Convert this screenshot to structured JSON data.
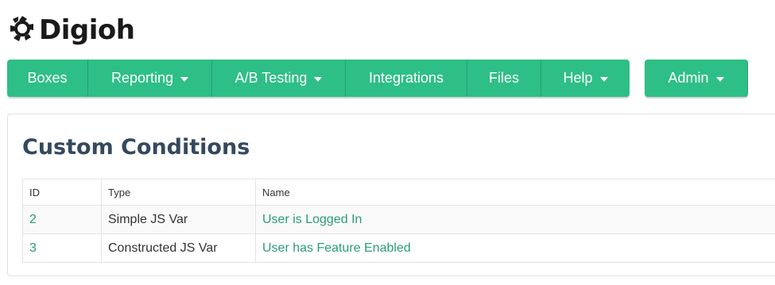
{
  "brand": {
    "name": "Digioh",
    "icon": "digioh-logo-icon",
    "color": "#2ebf86"
  },
  "nav": {
    "items": [
      {
        "label": "Boxes",
        "dropdown": false
      },
      {
        "label": "Reporting",
        "dropdown": true
      },
      {
        "label": "A/B Testing",
        "dropdown": true
      },
      {
        "label": "Integrations",
        "dropdown": false
      },
      {
        "label": "Files",
        "dropdown": false
      },
      {
        "label": "Help",
        "dropdown": true
      }
    ],
    "admin": {
      "label": "Admin",
      "dropdown": true
    }
  },
  "page": {
    "title": "Custom Conditions"
  },
  "table": {
    "headers": [
      "ID",
      "Type",
      "Name"
    ],
    "rows": [
      {
        "id": "2",
        "type": "Simple JS Var",
        "name": "User is Logged In"
      },
      {
        "id": "3",
        "type": "Constructed JS Var",
        "name": "User has Feature Enabled"
      }
    ]
  },
  "colors": {
    "accent": "#2ebf86",
    "link": "#2a9d76",
    "title": "#34495e"
  }
}
